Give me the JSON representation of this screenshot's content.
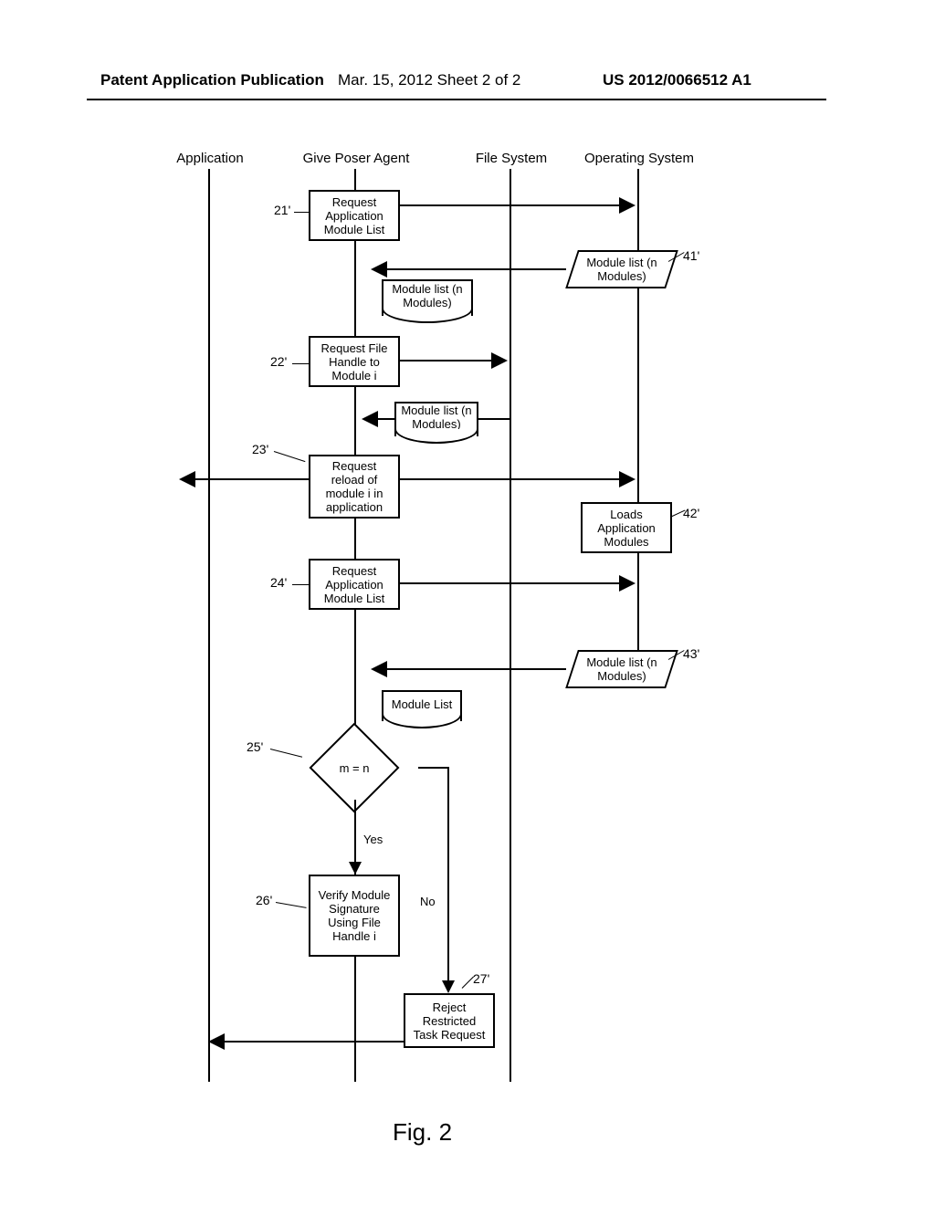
{
  "header": {
    "left": "Patent Application Publication",
    "mid": "Mar. 15, 2012  Sheet 2 of 2",
    "right": "US 2012/0066512 A1"
  },
  "lanes": {
    "application": "Application",
    "agent": "Give Poser Agent",
    "filesystem": "File System",
    "os": "Operating System"
  },
  "boxes": {
    "b21": "Request Application Module List",
    "b22": "Request File Handle to Module i",
    "b23": "Request reload of module i in application",
    "b24": "Request Application Module List",
    "b26": "Verify Module Signature Using File Handle i",
    "b27": "Reject Restricted Task Request",
    "b42": "Loads Application Modules"
  },
  "docs": {
    "d1": "Module list (n Modules)",
    "d2": "Module list (n Modules)",
    "d3": "Module List"
  },
  "pgrams": {
    "p41": "Module list (n Modules)",
    "p43": "Module list (n Modules)"
  },
  "decision": {
    "label": "m = n",
    "yes": "Yes",
    "no": "No"
  },
  "refs": {
    "r21": "21'",
    "r22": "22'",
    "r23": "23'",
    "r24": "24'",
    "r25": "25'",
    "r26": "26'",
    "r27": "27'",
    "r41": "41'",
    "r42": "42'",
    "r43": "43'"
  },
  "figure": "Fig. 2",
  "chart_data": {
    "type": "sequence-flowchart",
    "lanes": [
      "Application",
      "Give Poser Agent",
      "File System",
      "Operating System"
    ],
    "steps": [
      {
        "ref": "21'",
        "lane": "Give Poser Agent",
        "action": "Request Application Module List",
        "to": "Operating System"
      },
      {
        "ref": "41'",
        "lane": "Operating System",
        "artifact": "Module list (n Modules)",
        "return_to": "Give Poser Agent"
      },
      {
        "lane": "Give Poser Agent",
        "artifact": "Module list (n Modules)"
      },
      {
        "ref": "22'",
        "lane": "Give Poser Agent",
        "action": "Request File Handle to Module i",
        "to": "File System"
      },
      {
        "lane": "File System",
        "artifact": "Module list (n Modules)",
        "return_to": "Give Poser Agent"
      },
      {
        "ref": "23'",
        "lane": "Give Poser Agent",
        "action": "Request reload of module i in application",
        "to": [
          "Application",
          "Operating System"
        ]
      },
      {
        "ref": "42'",
        "lane": "Operating System",
        "action": "Loads Application Modules"
      },
      {
        "ref": "24'",
        "lane": "Give Poser Agent",
        "action": "Request Application Module List",
        "to": "Operating System"
      },
      {
        "ref": "43'",
        "lane": "Operating System",
        "artifact": "Module list (n Modules)",
        "return_to": "Give Poser Agent"
      },
      {
        "lane": "Give Poser Agent",
        "artifact": "Module List"
      },
      {
        "ref": "25'",
        "lane": "Give Poser Agent",
        "decision": "m = n",
        "yes_to": "26'",
        "no_to": "27'"
      },
      {
        "ref": "26'",
        "lane": "Give Poser Agent",
        "action": "Verify Module Signature Using File Handle i"
      },
      {
        "ref": "27'",
        "lane": "File System-area",
        "action": "Reject Restricted Task Request",
        "to": "Application"
      }
    ]
  }
}
